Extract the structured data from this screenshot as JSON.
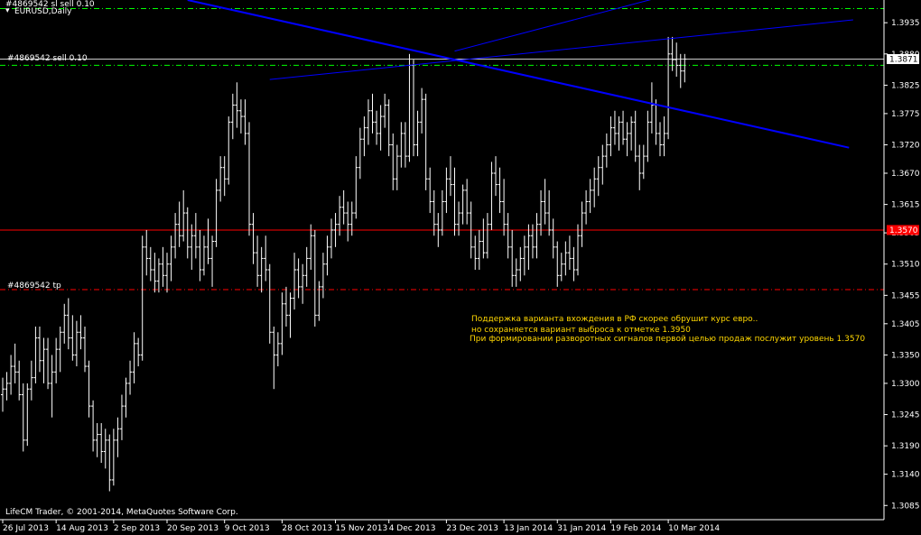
{
  "header": {
    "symbol_label": "EURUSD,Daily",
    "top_order_label": "#4869542 sl  sell 0.10"
  },
  "orders": {
    "sell_label": "#4869542 sell 0.10",
    "tp_label": "#4869542 tp"
  },
  "copyright": "LifeCM Trader, © 2001-2014, MetaQuotes Software Corp.",
  "annotation": {
    "line1": "Поддержка варианта вхождения в РФ скорее обрушит курс евро..",
    "line2": "но сохраняется вариант выброса к отметке 1.3950",
    "line3": "При формировании разворотных сигналов первой целью продаж послужит уровень 1.3570"
  },
  "colors": {
    "background": "#000000",
    "bars": "#ffffff",
    "trendline": "#0000ff",
    "red_level": "#ff0000",
    "tp_line": "#ff0000",
    "order_line": "#00ff00",
    "axis": "#ffffff",
    "annotation_text": "#ffd700",
    "current_price_box": "#ffffff",
    "red_price_box": "#ff0000"
  },
  "chart_data": {
    "type": "ohlc",
    "symbol": "EURUSD",
    "timeframe": "Daily",
    "ylim": [
      1.306,
      1.3975
    ],
    "y_ticks": [
      1.3935,
      1.388,
      1.3825,
      1.3775,
      1.372,
      1.367,
      1.3615,
      1.3565,
      1.351,
      1.3455,
      1.3405,
      1.335,
      1.33,
      1.3245,
      1.319,
      1.314,
      1.3085
    ],
    "y_tick_labels": [
      "1.3935",
      "1.3880",
      "1.3825",
      "1.3775",
      "1.3720",
      "1.3670",
      "1.3615",
      "1.3565",
      "1.3510",
      "1.3455",
      "1.3405",
      "1.3350",
      "1.3300",
      "1.3245",
      "1.3190",
      "1.3140",
      "1.3085"
    ],
    "x_tick_labels": [
      "26 Jul 2013",
      "14 Aug 2013",
      "2 Sep 2013",
      "20 Sep 2013",
      "9 Oct 2013",
      "28 Oct 2013",
      "15 Nov 2013",
      "4 Dec 2013",
      "23 Dec 2013",
      "13 Jan 2014",
      "31 Jan 2014",
      "19 Feb 2014",
      "10 Mar 2014"
    ],
    "x_tick_bar_index": [
      0,
      13,
      27,
      40,
      54,
      68,
      81,
      94,
      108,
      122,
      135,
      148,
      162
    ],
    "current_price": 1.3871,
    "current_price_label": "1.3871",
    "red_level": 1.357,
    "red_level_label": "1.3570",
    "sell_price": 1.386,
    "sl_price": 1.396,
    "tp_price": 1.3465,
    "trendlines": [
      {
        "name": "falling",
        "from": {
          "bar": 45,
          "price": 1.3975
        },
        "to": {
          "bar": 206,
          "price": 1.3715
        }
      },
      {
        "name": "rising-upper",
        "from": {
          "bar": 65,
          "price": 1.3835
        },
        "to": {
          "bar": 207,
          "price": 1.394
        }
      },
      {
        "name": "rising-lower",
        "from": {
          "bar": 110,
          "price": 1.3885
        },
        "to": {
          "bar": 160,
          "price": 1.398
        }
      }
    ],
    "bars": [
      [
        1.328,
        1.331,
        1.325,
        1.329
      ],
      [
        1.329,
        1.332,
        1.327,
        1.33
      ],
      [
        1.33,
        1.335,
        1.328,
        1.333
      ],
      [
        1.333,
        1.337,
        1.33,
        1.332
      ],
      [
        1.332,
        1.334,
        1.327,
        1.328
      ],
      [
        1.328,
        1.33,
        1.318,
        1.32
      ],
      [
        1.32,
        1.33,
        1.319,
        1.329
      ],
      [
        1.329,
        1.334,
        1.327,
        1.331
      ],
      [
        1.331,
        1.34,
        1.33,
        1.338
      ],
      [
        1.338,
        1.34,
        1.332,
        1.334
      ],
      [
        1.334,
        1.338,
        1.33,
        1.336
      ],
      [
        1.336,
        1.338,
        1.329,
        1.33
      ],
      [
        1.33,
        1.335,
        1.324,
        1.332
      ],
      [
        1.332,
        1.338,
        1.33,
        1.336
      ],
      [
        1.336,
        1.34,
        1.332,
        1.339
      ],
      [
        1.339,
        1.344,
        1.337,
        1.342
      ],
      [
        1.342,
        1.345,
        1.336,
        1.338
      ],
      [
        1.338,
        1.342,
        1.334,
        1.335
      ],
      [
        1.335,
        1.341,
        1.333,
        1.339
      ],
      [
        1.339,
        1.342,
        1.336,
        1.338
      ],
      [
        1.338,
        1.34,
        1.332,
        1.333
      ],
      [
        1.333,
        1.334,
        1.324,
        1.326
      ],
      [
        1.326,
        1.327,
        1.318,
        1.32
      ],
      [
        1.32,
        1.323,
        1.317,
        1.321
      ],
      [
        1.321,
        1.323,
        1.316,
        1.318
      ],
      [
        1.318,
        1.322,
        1.315,
        1.32
      ],
      [
        1.32,
        1.321,
        1.311,
        1.313
      ],
      [
        1.313,
        1.322,
        1.312,
        1.32
      ],
      [
        1.32,
        1.324,
        1.317,
        1.322
      ],
      [
        1.322,
        1.328,
        1.32,
        1.326
      ],
      [
        1.326,
        1.331,
        1.324,
        1.33
      ],
      [
        1.33,
        1.334,
        1.328,
        1.332
      ],
      [
        1.332,
        1.339,
        1.33,
        1.337
      ],
      [
        1.337,
        1.338,
        1.333,
        1.335
      ],
      [
        1.335,
        1.356,
        1.334,
        1.354
      ],
      [
        1.354,
        1.357,
        1.349,
        1.352
      ],
      [
        1.352,
        1.354,
        1.348,
        1.35
      ],
      [
        1.35,
        1.353,
        1.346,
        1.348
      ],
      [
        1.348,
        1.352,
        1.346,
        1.351
      ],
      [
        1.351,
        1.354,
        1.347,
        1.349
      ],
      [
        1.349,
        1.353,
        1.346,
        1.351
      ],
      [
        1.351,
        1.356,
        1.348,
        1.354
      ],
      [
        1.354,
        1.36,
        1.352,
        1.358
      ],
      [
        1.358,
        1.362,
        1.354,
        1.356
      ],
      [
        1.356,
        1.364,
        1.355,
        1.36
      ],
      [
        1.36,
        1.361,
        1.352,
        1.354
      ],
      [
        1.354,
        1.358,
        1.35,
        1.356
      ],
      [
        1.356,
        1.36,
        1.352,
        1.354
      ],
      [
        1.354,
        1.357,
        1.348,
        1.35
      ],
      [
        1.35,
        1.356,
        1.349,
        1.354
      ],
      [
        1.354,
        1.359,
        1.351,
        1.352
      ],
      [
        1.352,
        1.356,
        1.347,
        1.355
      ],
      [
        1.355,
        1.366,
        1.354,
        1.364
      ],
      [
        1.364,
        1.37,
        1.362,
        1.368
      ],
      [
        1.368,
        1.37,
        1.363,
        1.366
      ],
      [
        1.366,
        1.377,
        1.365,
        1.376
      ],
      [
        1.376,
        1.381,
        1.373,
        1.379
      ],
      [
        1.379,
        1.383,
        1.375,
        1.378
      ],
      [
        1.378,
        1.38,
        1.374,
        1.377
      ],
      [
        1.377,
        1.38,
        1.372,
        1.374
      ],
      [
        1.374,
        1.376,
        1.356,
        1.358
      ],
      [
        1.358,
        1.36,
        1.351,
        1.353
      ],
      [
        1.353,
        1.356,
        1.347,
        1.349
      ],
      [
        1.349,
        1.354,
        1.346,
        1.352
      ],
      [
        1.352,
        1.356,
        1.348,
        1.35
      ],
      [
        1.35,
        1.351,
        1.337,
        1.339
      ],
      [
        1.339,
        1.34,
        1.329,
        1.335
      ],
      [
        1.335,
        1.339,
        1.333,
        1.337
      ],
      [
        1.337,
        1.346,
        1.335,
        1.344
      ],
      [
        1.344,
        1.347,
        1.34,
        1.342
      ],
      [
        1.342,
        1.346,
        1.338,
        1.345
      ],
      [
        1.345,
        1.353,
        1.343,
        1.35
      ],
      [
        1.35,
        1.352,
        1.345,
        1.347
      ],
      [
        1.347,
        1.351,
        1.344,
        1.349
      ],
      [
        1.349,
        1.354,
        1.347,
        1.352
      ],
      [
        1.352,
        1.358,
        1.35,
        1.356
      ],
      [
        1.356,
        1.357,
        1.34,
        1.342
      ],
      [
        1.342,
        1.348,
        1.341,
        1.347
      ],
      [
        1.347,
        1.353,
        1.345,
        1.351
      ],
      [
        1.351,
        1.356,
        1.349,
        1.354
      ],
      [
        1.354,
        1.359,
        1.352,
        1.357
      ],
      [
        1.357,
        1.36,
        1.354,
        1.358
      ],
      [
        1.358,
        1.363,
        1.356,
        1.361
      ],
      [
        1.361,
        1.364,
        1.358,
        1.36
      ],
      [
        1.36,
        1.362,
        1.355,
        1.358
      ],
      [
        1.358,
        1.362,
        1.356,
        1.36
      ],
      [
        1.36,
        1.37,
        1.359,
        1.368
      ],
      [
        1.368,
        1.375,
        1.366,
        1.373
      ],
      [
        1.373,
        1.377,
        1.37,
        1.375
      ],
      [
        1.375,
        1.38,
        1.372,
        1.378
      ],
      [
        1.378,
        1.381,
        1.374,
        1.376
      ],
      [
        1.376,
        1.378,
        1.372,
        1.374
      ],
      [
        1.374,
        1.379,
        1.371,
        1.377
      ],
      [
        1.377,
        1.381,
        1.375,
        1.379
      ],
      [
        1.379,
        1.38,
        1.37,
        1.372
      ],
      [
        1.372,
        1.374,
        1.364,
        1.366
      ],
      [
        1.366,
        1.372,
        1.364,
        1.37
      ],
      [
        1.37,
        1.376,
        1.368,
        1.374
      ],
      [
        1.374,
        1.376,
        1.368,
        1.37
      ],
      [
        1.37,
        1.388,
        1.369,
        1.386
      ],
      [
        1.386,
        1.387,
        1.37,
        1.372
      ],
      [
        1.372,
        1.378,
        1.37,
        1.376
      ],
      [
        1.376,
        1.382,
        1.374,
        1.38
      ],
      [
        1.38,
        1.381,
        1.364,
        1.366
      ],
      [
        1.366,
        1.368,
        1.36,
        1.362
      ],
      [
        1.362,
        1.364,
        1.356,
        1.358
      ],
      [
        1.358,
        1.36,
        1.354,
        1.357
      ],
      [
        1.357,
        1.364,
        1.356,
        1.362
      ],
      [
        1.362,
        1.368,
        1.36,
        1.366
      ],
      [
        1.366,
        1.37,
        1.363,
        1.365
      ],
      [
        1.365,
        1.368,
        1.356,
        1.358
      ],
      [
        1.358,
        1.362,
        1.356,
        1.36
      ],
      [
        1.36,
        1.365,
        1.358,
        1.364
      ],
      [
        1.364,
        1.366,
        1.358,
        1.36
      ],
      [
        1.36,
        1.362,
        1.352,
        1.354
      ],
      [
        1.354,
        1.356,
        1.35,
        1.352
      ],
      [
        1.352,
        1.357,
        1.35,
        1.355
      ],
      [
        1.355,
        1.359,
        1.352,
        1.353
      ],
      [
        1.353,
        1.36,
        1.352,
        1.358
      ],
      [
        1.358,
        1.369,
        1.357,
        1.367
      ],
      [
        1.367,
        1.37,
        1.363,
        1.365
      ],
      [
        1.365,
        1.368,
        1.36,
        1.362
      ],
      [
        1.362,
        1.366,
        1.356,
        1.358
      ],
      [
        1.358,
        1.36,
        1.352,
        1.354
      ],
      [
        1.354,
        1.357,
        1.347,
        1.349
      ],
      [
        1.349,
        1.352,
        1.347,
        1.35
      ],
      [
        1.35,
        1.354,
        1.348,
        1.352
      ],
      [
        1.352,
        1.356,
        1.349,
        1.354
      ],
      [
        1.354,
        1.358,
        1.35,
        1.356
      ],
      [
        1.356,
        1.358,
        1.352,
        1.354
      ],
      [
        1.354,
        1.36,
        1.352,
        1.358
      ],
      [
        1.358,
        1.364,
        1.356,
        1.362
      ],
      [
        1.362,
        1.366,
        1.358,
        1.36
      ],
      [
        1.36,
        1.364,
        1.356,
        1.357
      ],
      [
        1.357,
        1.359,
        1.352,
        1.354
      ],
      [
        1.354,
        1.355,
        1.347,
        1.349
      ],
      [
        1.349,
        1.353,
        1.348,
        1.351
      ],
      [
        1.351,
        1.355,
        1.349,
        1.353
      ],
      [
        1.353,
        1.356,
        1.35,
        1.352
      ],
      [
        1.352,
        1.354,
        1.348,
        1.35
      ],
      [
        1.35,
        1.358,
        1.349,
        1.356
      ],
      [
        1.356,
        1.362,
        1.354,
        1.36
      ],
      [
        1.36,
        1.364,
        1.358,
        1.362
      ],
      [
        1.362,
        1.366,
        1.36,
        1.364
      ],
      [
        1.364,
        1.368,
        1.361,
        1.366
      ],
      [
        1.366,
        1.37,
        1.363,
        1.368
      ],
      [
        1.368,
        1.372,
        1.365,
        1.37
      ],
      [
        1.37,
        1.374,
        1.368,
        1.372
      ],
      [
        1.372,
        1.377,
        1.37,
        1.375
      ],
      [
        1.375,
        1.378,
        1.372,
        1.374
      ],
      [
        1.374,
        1.377,
        1.371,
        1.376
      ],
      [
        1.376,
        1.378,
        1.372,
        1.373
      ],
      [
        1.373,
        1.376,
        1.37,
        1.374
      ],
      [
        1.374,
        1.377,
        1.371,
        1.376
      ],
      [
        1.376,
        1.378,
        1.369,
        1.37
      ],
      [
        1.37,
        1.372,
        1.364,
        1.367
      ],
      [
        1.367,
        1.372,
        1.366,
        1.37
      ],
      [
        1.37,
        1.378,
        1.369,
        1.376
      ],
      [
        1.376,
        1.383,
        1.374,
        1.379
      ],
      [
        1.379,
        1.38,
        1.372,
        1.374
      ],
      [
        1.374,
        1.376,
        1.37,
        1.372
      ],
      [
        1.372,
        1.377,
        1.37,
        1.374
      ],
      [
        1.374,
        1.391,
        1.373,
        1.388
      ],
      [
        1.388,
        1.391,
        1.385,
        1.387
      ],
      [
        1.387,
        1.39,
        1.384,
        1.386
      ],
      [
        1.386,
        1.388,
        1.382,
        1.385
      ],
      [
        1.385,
        1.388,
        1.383,
        1.3871
      ]
    ]
  }
}
